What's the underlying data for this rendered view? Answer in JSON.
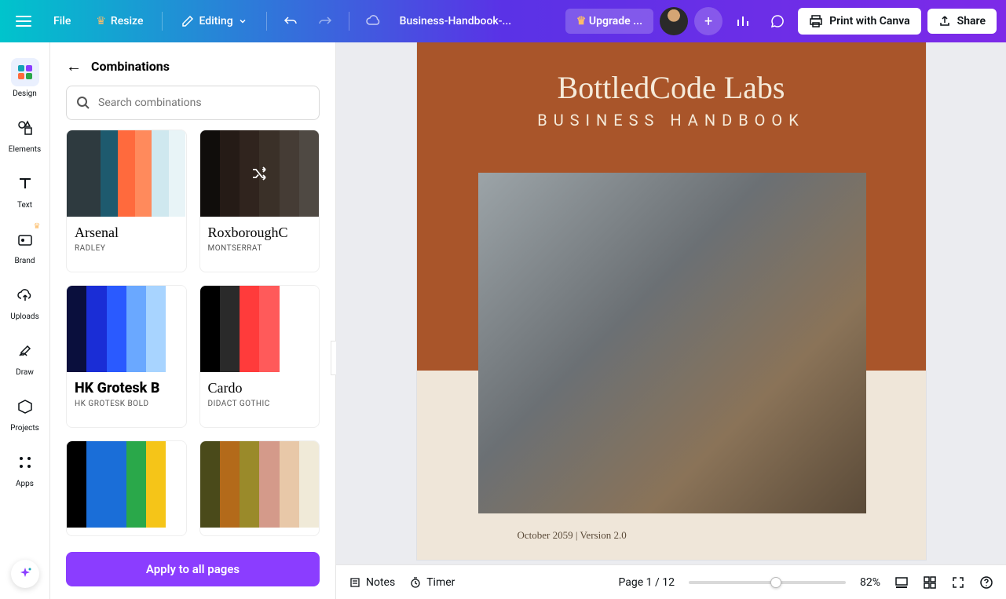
{
  "topbar": {
    "file": "File",
    "resize": "Resize",
    "editing": "Editing",
    "doc_title": "Business-Handbook-...",
    "upgrade": "Upgrade ...",
    "print": "Print with Canva",
    "share": "Share"
  },
  "rail": {
    "design": "Design",
    "elements": "Elements",
    "text": "Text",
    "brand": "Brand",
    "uploads": "Uploads",
    "draw": "Draw",
    "projects": "Projects",
    "apps": "Apps"
  },
  "panel": {
    "title": "Combinations",
    "search_placeholder": "Search combinations",
    "apply": "Apply to all pages",
    "combos": [
      {
        "title": "Arsenal",
        "sub": "Radley",
        "title_style": "font-family:Georgia,serif;font-weight:400",
        "colors": [
          "#2e3a3f",
          "#2e3a3f",
          "#1e5a6e",
          "#ff6a3d",
          "#ff8a5c",
          "#cfe8ef",
          "#e8f4f7"
        ]
      },
      {
        "title": "RoxboroughC",
        "sub": "MONTSERRAT",
        "title_style": "font-family:Georgia,serif;font-weight:400",
        "colors": [
          "#1a1412",
          "#3a2a22",
          "#4a382e",
          "#5a4a3e",
          "#6b5d52",
          "#7a7068"
        ],
        "shuffle": true
      },
      {
        "title": "HK Grotesk B",
        "sub": "HK GROTESK BOLD",
        "title_style": "font-weight:800",
        "colors": [
          "#0a0f3d",
          "#1a2dd6",
          "#2a5aff",
          "#6aa8ff",
          "#a8d4ff",
          "#ffffff"
        ]
      },
      {
        "title": "Cardo",
        "sub": "Didact Gothic",
        "title_style": "font-family:Georgia,serif;font-weight:400",
        "colors": [
          "#000000",
          "#2a2a2a",
          "#ff3b3b",
          "#ff5a5a",
          "#ffffff",
          "#ffffff"
        ]
      },
      {
        "title": "",
        "sub": "",
        "colors": [
          "#000000",
          "#1a6ed8",
          "#1a6ed8",
          "#2aa84a",
          "#f5c518",
          "#ffffff"
        ]
      },
      {
        "title": "",
        "sub": "",
        "colors": [
          "#4a4a1a",
          "#b36a1a",
          "#9a8a2a",
          "#d49a8a",
          "#e8c8a8",
          "#f0ead8"
        ]
      }
    ]
  },
  "page": {
    "brand": "BottledCode Labs",
    "subtitle": "BUSINESS HANDBOOK",
    "footer": "October 2059 | Version 2.0"
  },
  "bottombar": {
    "notes": "Notes",
    "timer": "Timer",
    "page_counter": "Page 1 / 12",
    "zoom": "82%"
  }
}
